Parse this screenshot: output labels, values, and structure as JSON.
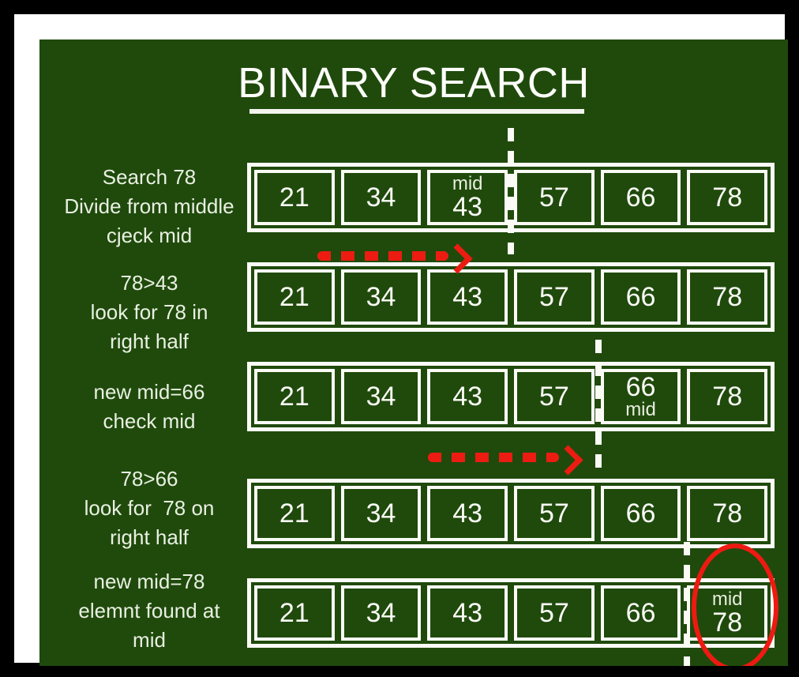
{
  "poster": {
    "title": "BINARY SEARCH",
    "board_color": "#1f4a0c",
    "frame_color": "#ffffff",
    "outer_color": "#000000",
    "accent_red": "#ec1c12",
    "text_color": "#fbfbf6"
  },
  "notes": [
    {
      "id": "step-1",
      "text": "Search 78\nDivide from middle\ncjeck mid"
    },
    {
      "id": "step-2",
      "text": "78>43\nlook for 78 in\nright half"
    },
    {
      "id": "step-3",
      "text": "new mid=66\ncheck mid"
    },
    {
      "id": "step-4",
      "text": "78>66\nlook for  78 on\nright half"
    },
    {
      "id": "step-5",
      "text": "new mid=78\nelemnt found at\nmid"
    }
  ],
  "rows": [
    {
      "id": "row-1",
      "values": [
        "21",
        "34",
        "43",
        "57",
        "66",
        "78"
      ],
      "tags": [
        null,
        null,
        {
          "label": "mid",
          "position": "above"
        },
        null,
        null,
        null
      ]
    },
    {
      "id": "row-2",
      "values": [
        "21",
        "34",
        "43",
        "57",
        "66",
        "78"
      ],
      "tags": [
        null,
        null,
        null,
        null,
        null,
        null
      ]
    },
    {
      "id": "row-3",
      "values": [
        "21",
        "34",
        "43",
        "57",
        "66",
        "78"
      ],
      "tags": [
        null,
        null,
        null,
        null,
        {
          "label": "mid",
          "position": "below"
        },
        null
      ]
    },
    {
      "id": "row-4",
      "values": [
        "21",
        "34",
        "43",
        "57",
        "66",
        "78"
      ],
      "tags": [
        null,
        null,
        null,
        null,
        null,
        null
      ]
    },
    {
      "id": "row-5",
      "values": [
        "21",
        "34",
        "43",
        "57",
        "66",
        "78"
      ],
      "tags": [
        null,
        null,
        null,
        null,
        null,
        {
          "label": "mid",
          "position": "above"
        }
      ]
    }
  ],
  "split_lines": [
    {
      "id": "divider-row-1",
      "after_index": 3
    },
    {
      "id": "divider-row-3",
      "after_index": 4
    },
    {
      "id": "divider-row-5",
      "after_index": 5
    }
  ],
  "arrows": [
    {
      "id": "arrow-right-half-1",
      "direction": "right"
    },
    {
      "id": "arrow-right-half-2",
      "direction": "right"
    }
  ],
  "highlight": {
    "id": "found-element",
    "target_value": "78",
    "shape": "ellipse"
  },
  "chart_data": {
    "type": "table",
    "title": "BINARY SEARCH",
    "target": 78,
    "array": [
      21,
      34,
      43,
      57,
      66,
      78
    ],
    "steps": [
      {
        "step": 1,
        "mid_index": 2,
        "mid_value": 43,
        "note": "Search 78 / Divide from middle / cjeck mid",
        "split_after_index": 3,
        "arrow": "right"
      },
      {
        "step": 2,
        "mid_index": null,
        "mid_value": null,
        "note": "78>43 / look for 78 in / right half",
        "split_after_index": null,
        "arrow": null
      },
      {
        "step": 3,
        "mid_index": 4,
        "mid_value": 66,
        "note": "new mid=66 / check mid",
        "split_after_index": 4,
        "arrow": "right"
      },
      {
        "step": 4,
        "mid_index": null,
        "mid_value": null,
        "note": "78>66 / look for  78 on / right half",
        "split_after_index": null,
        "arrow": null
      },
      {
        "step": 5,
        "mid_index": 5,
        "mid_value": 78,
        "note": "new mid=78 / elemnt found at / mid",
        "split_after_index": 5,
        "arrow": null,
        "found": true
      }
    ]
  }
}
